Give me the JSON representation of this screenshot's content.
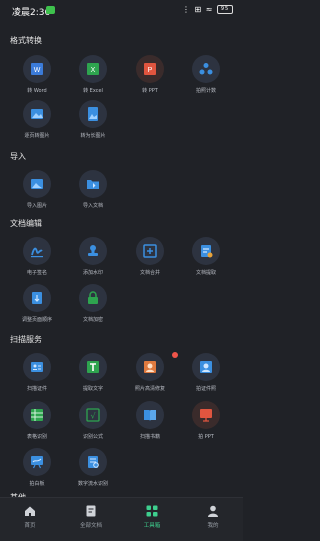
{
  "status": {
    "time": "凌晨2:36",
    "right": "⋮ ⊞ ≈",
    "battery": "95"
  },
  "sections": [
    {
      "title": "格式转换",
      "tools": [
        "转 Word",
        "转 Excel",
        "转 PPT",
        "拍照计数",
        "逐页转图片",
        "转为长图片"
      ]
    },
    {
      "title": "导入",
      "tools": [
        "导入图片",
        "导入文档"
      ]
    },
    {
      "title": "文档编辑",
      "tools": [
        "电子签名",
        "添加水印",
        "文档合并",
        "文档提取",
        "调整页面顺序",
        "文档加密"
      ]
    },
    {
      "title": "扫描服务",
      "tools": [
        "扫描证件",
        "提取文字",
        "照片高清修复",
        "拍证件照",
        "表格识别",
        "识别公式",
        "扫描书籍",
        "拍 PPT",
        "拍白板",
        "数字流水识别"
      ]
    },
    {
      "title": "其他",
      "tools": []
    }
  ],
  "tabs": [
    "首页",
    "全部文档",
    "工具箱",
    "我的"
  ],
  "colors": {
    "accent": "#3ecf8e",
    "bg": "#202227",
    "badge": "#f0554a"
  }
}
